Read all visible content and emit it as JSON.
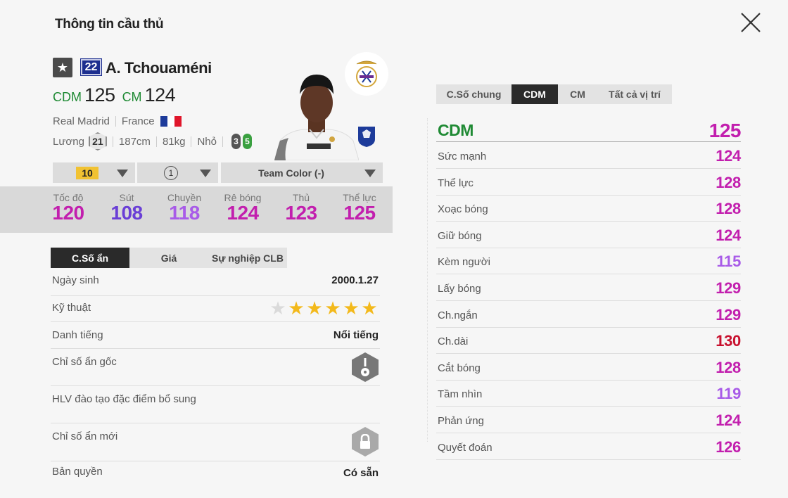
{
  "page": {
    "title": "Thông tin cầu thủ"
  },
  "player": {
    "star_icon": "star-icon",
    "season_badge": "22",
    "name": "A. Tchouaméni",
    "positions": [
      {
        "label": "CDM",
        "value": "125"
      },
      {
        "label": "CM",
        "value": "124"
      }
    ],
    "club": "Real Madrid",
    "nation": "France",
    "salary_label": "Lương",
    "salary": "21",
    "height": "187cm",
    "weight": "81kg",
    "body_type": "Nhỏ",
    "left_foot": "3",
    "right_foot": "5"
  },
  "selectors": {
    "level": "10",
    "team_color_level": "1",
    "team_color": "Team Color (-)"
  },
  "stats": [
    {
      "label": "Tốc độ",
      "value": "120",
      "color": "#c21fae"
    },
    {
      "label": "Sút",
      "value": "108",
      "color": "#6a3fd6"
    },
    {
      "label": "Chuyền",
      "value": "118",
      "color": "#a85be8"
    },
    {
      "label": "Rê bóng",
      "value": "124",
      "color": "#c21fae"
    },
    {
      "label": "Thủ",
      "value": "123",
      "color": "#c21fae"
    },
    {
      "label": "Thể lực",
      "value": "125",
      "color": "#c21fae"
    }
  ],
  "left_tabs": [
    {
      "label": "C.Số ẩn",
      "active": true
    },
    {
      "label": "Giá",
      "active": false
    },
    {
      "label": "Sự nghiệp CLB",
      "active": false
    }
  ],
  "info": {
    "birth_label": "Ngày sinh",
    "birth": "2000.1.27",
    "skill_label": "Kỹ thuật",
    "skill_stars": 5,
    "fame_label": "Danh tiếng",
    "fame": "Nổi tiếng",
    "orig_traits_label": "Chỉ số ẩn gốc",
    "coach_label": "HLV đào tạo đặc điểm bổ sung",
    "new_traits_label": "Chỉ số ẩn mới",
    "license_label": "Bản quyền",
    "license": "Có sẵn"
  },
  "right_tabs": [
    {
      "label": "C.Số chung",
      "active": false
    },
    {
      "label": "CDM",
      "active": true
    },
    {
      "label": "CM",
      "active": false
    },
    {
      "label": "Tất cả vị trí",
      "active": false
    }
  ],
  "position_detail": {
    "position": "CDM",
    "overall": "125",
    "overall_color": "#c21fae",
    "position_color": "#1f8a34",
    "attributes": [
      {
        "label": "Sức mạnh",
        "value": "124",
        "color": "#c21fae"
      },
      {
        "label": "Thể lực",
        "value": "128",
        "color": "#c21fae"
      },
      {
        "label": "Xoạc bóng",
        "value": "128",
        "color": "#c21fae"
      },
      {
        "label": "Giữ bóng",
        "value": "124",
        "color": "#c21fae"
      },
      {
        "label": "Kèm người",
        "value": "115",
        "color": "#a85be8"
      },
      {
        "label": "Lấy bóng",
        "value": "129",
        "color": "#c21fae"
      },
      {
        "label": "Ch.ngắn",
        "value": "129",
        "color": "#c21fae"
      },
      {
        "label": "Ch.dài",
        "value": "130",
        "color": "#c8102e"
      },
      {
        "label": "Cắt bóng",
        "value": "128",
        "color": "#c21fae"
      },
      {
        "label": "Tầm nhìn",
        "value": "119",
        "color": "#a85be8"
      },
      {
        "label": "Phản ứng",
        "value": "124",
        "color": "#c21fae"
      },
      {
        "label": "Quyết đoán",
        "value": "126",
        "color": "#c21fae"
      }
    ]
  },
  "colors": {
    "flag": [
      "#1d3b9a",
      "#ffffff",
      "#e0162b"
    ],
    "level_chip": "#f1c232"
  }
}
